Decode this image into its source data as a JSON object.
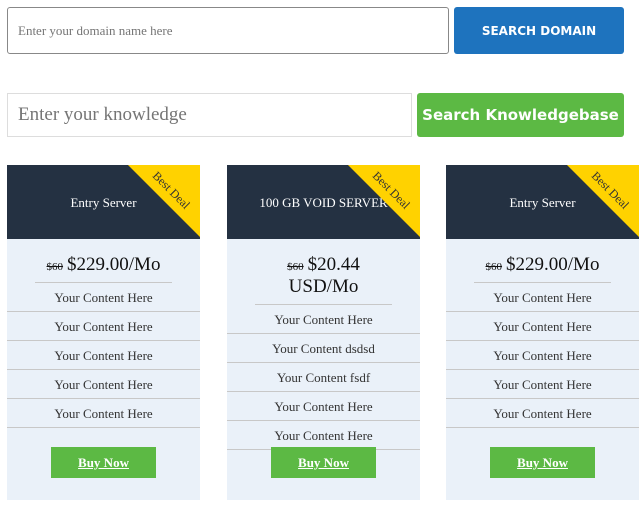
{
  "domain_search": {
    "placeholder": "Enter your domain name here",
    "button": "SEARCH DOMAIN",
    "button_color": "#1e73be"
  },
  "kb_search": {
    "placeholder": "Enter your knowledge",
    "button": "Search Knowledgebase",
    "button_color": "#5cb944"
  },
  "cards": [
    {
      "title": "Entry Server",
      "ribbon": "Best Deal",
      "old_price": "$60",
      "price": "$229.00/Mo",
      "features": [
        "Your Content Here",
        "Your Content Here",
        "Your Content Here",
        "Your Content Here",
        "Your Content Here"
      ],
      "button": "Buy Now"
    },
    {
      "title": "100 GB VOID SERVER",
      "ribbon": "Best Deal",
      "old_price": "$60",
      "price": "$20.44 USD/Mo",
      "features": [
        "Your Content Here",
        "Your Content dsdsd",
        "Your Content fsdf",
        "Your Content Here",
        "Your Content Here"
      ],
      "button": "Buy Now"
    },
    {
      "title": "Entry Server",
      "ribbon": "Best Deal",
      "old_price": "$60",
      "price": "$229.00/Mo",
      "features": [
        "Your Content Here",
        "Your Content Here",
        "Your Content Here",
        "Your Content Here",
        "Your Content Here"
      ],
      "button": "Buy Now"
    }
  ]
}
